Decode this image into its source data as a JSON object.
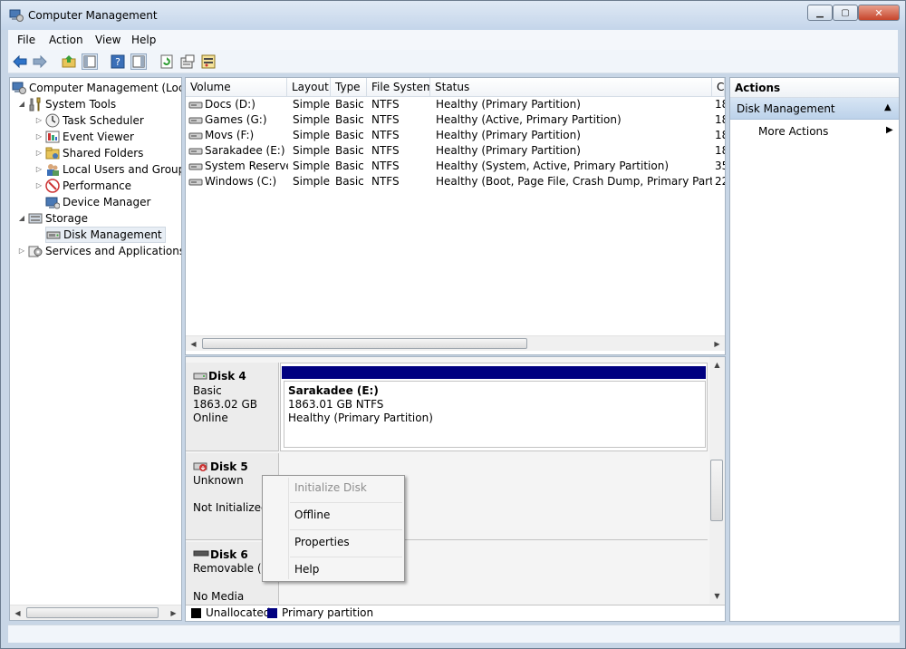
{
  "window": {
    "title": "Computer Management"
  },
  "menu": {
    "file": "File",
    "action": "Action",
    "view": "View",
    "help": "Help"
  },
  "toolbar": {
    "icons": [
      "back-arrow-icon",
      "forward-arrow-icon",
      "up-folder-icon",
      "show-hide-tree-icon",
      "help-icon",
      "show-hide-action-pane-icon",
      "refresh-icon",
      "properties-icon",
      "export-list-icon"
    ]
  },
  "tree": {
    "root": "Computer Management (Local",
    "system_tools": "System Tools",
    "task_scheduler": "Task Scheduler",
    "event_viewer": "Event Viewer",
    "shared_folders": "Shared Folders",
    "local_users": "Local Users and Groups",
    "performance": "Performance",
    "device_manager": "Device Manager",
    "storage": "Storage",
    "disk_management": "Disk Management",
    "services": "Services and Applications"
  },
  "volumes": {
    "headers": {
      "volume": "Volume",
      "layout": "Layout",
      "type": "Type",
      "fs": "File System",
      "status": "Status",
      "cap": "C"
    },
    "rows": [
      {
        "volume": "Docs (D:)",
        "layout": "Simple",
        "type": "Basic",
        "fs": "NTFS",
        "status": "Healthy (Primary Partition)",
        "cap": "18"
      },
      {
        "volume": "Games (G:)",
        "layout": "Simple",
        "type": "Basic",
        "fs": "NTFS",
        "status": "Healthy (Active, Primary Partition)",
        "cap": "18"
      },
      {
        "volume": "Movs (F:)",
        "layout": "Simple",
        "type": "Basic",
        "fs": "NTFS",
        "status": "Healthy (Primary Partition)",
        "cap": "18"
      },
      {
        "volume": "Sarakadee (E:)",
        "layout": "Simple",
        "type": "Basic",
        "fs": "NTFS",
        "status": "Healthy (Primary Partition)",
        "cap": "18"
      },
      {
        "volume": "System Reserved",
        "layout": "Simple",
        "type": "Basic",
        "fs": "NTFS",
        "status": "Healthy (System, Active, Primary Partition)",
        "cap": "35"
      },
      {
        "volume": "Windows (C:)",
        "layout": "Simple",
        "type": "Basic",
        "fs": "NTFS",
        "status": "Healthy (Boot, Page File, Crash Dump, Primary Partition)",
        "cap": "22"
      }
    ]
  },
  "disks": {
    "disk4": {
      "name": "Disk 4",
      "kind": "Basic",
      "size": "1863.02 GB",
      "state": "Online",
      "partition": {
        "name": "Sarakadee  (E:)",
        "size": "1863.01 GB NTFS",
        "status": "Healthy (Primary Partition)"
      }
    },
    "disk5": {
      "name": "Disk 5",
      "kind": "Unknown",
      "state": "Not Initialized"
    },
    "disk6": {
      "name": "Disk 6",
      "kind": "Removable (S:",
      "state": "No Media"
    }
  },
  "legend": {
    "unallocated": "Unallocated",
    "primary": "Primary partition",
    "unallocated_color": "#000000",
    "primary_color": "#000080"
  },
  "context_menu": {
    "initialize": "Initialize Disk",
    "offline": "Offline",
    "properties": "Properties",
    "help": "Help"
  },
  "actions": {
    "header": "Actions",
    "section": "Disk Management",
    "more": "More Actions"
  }
}
